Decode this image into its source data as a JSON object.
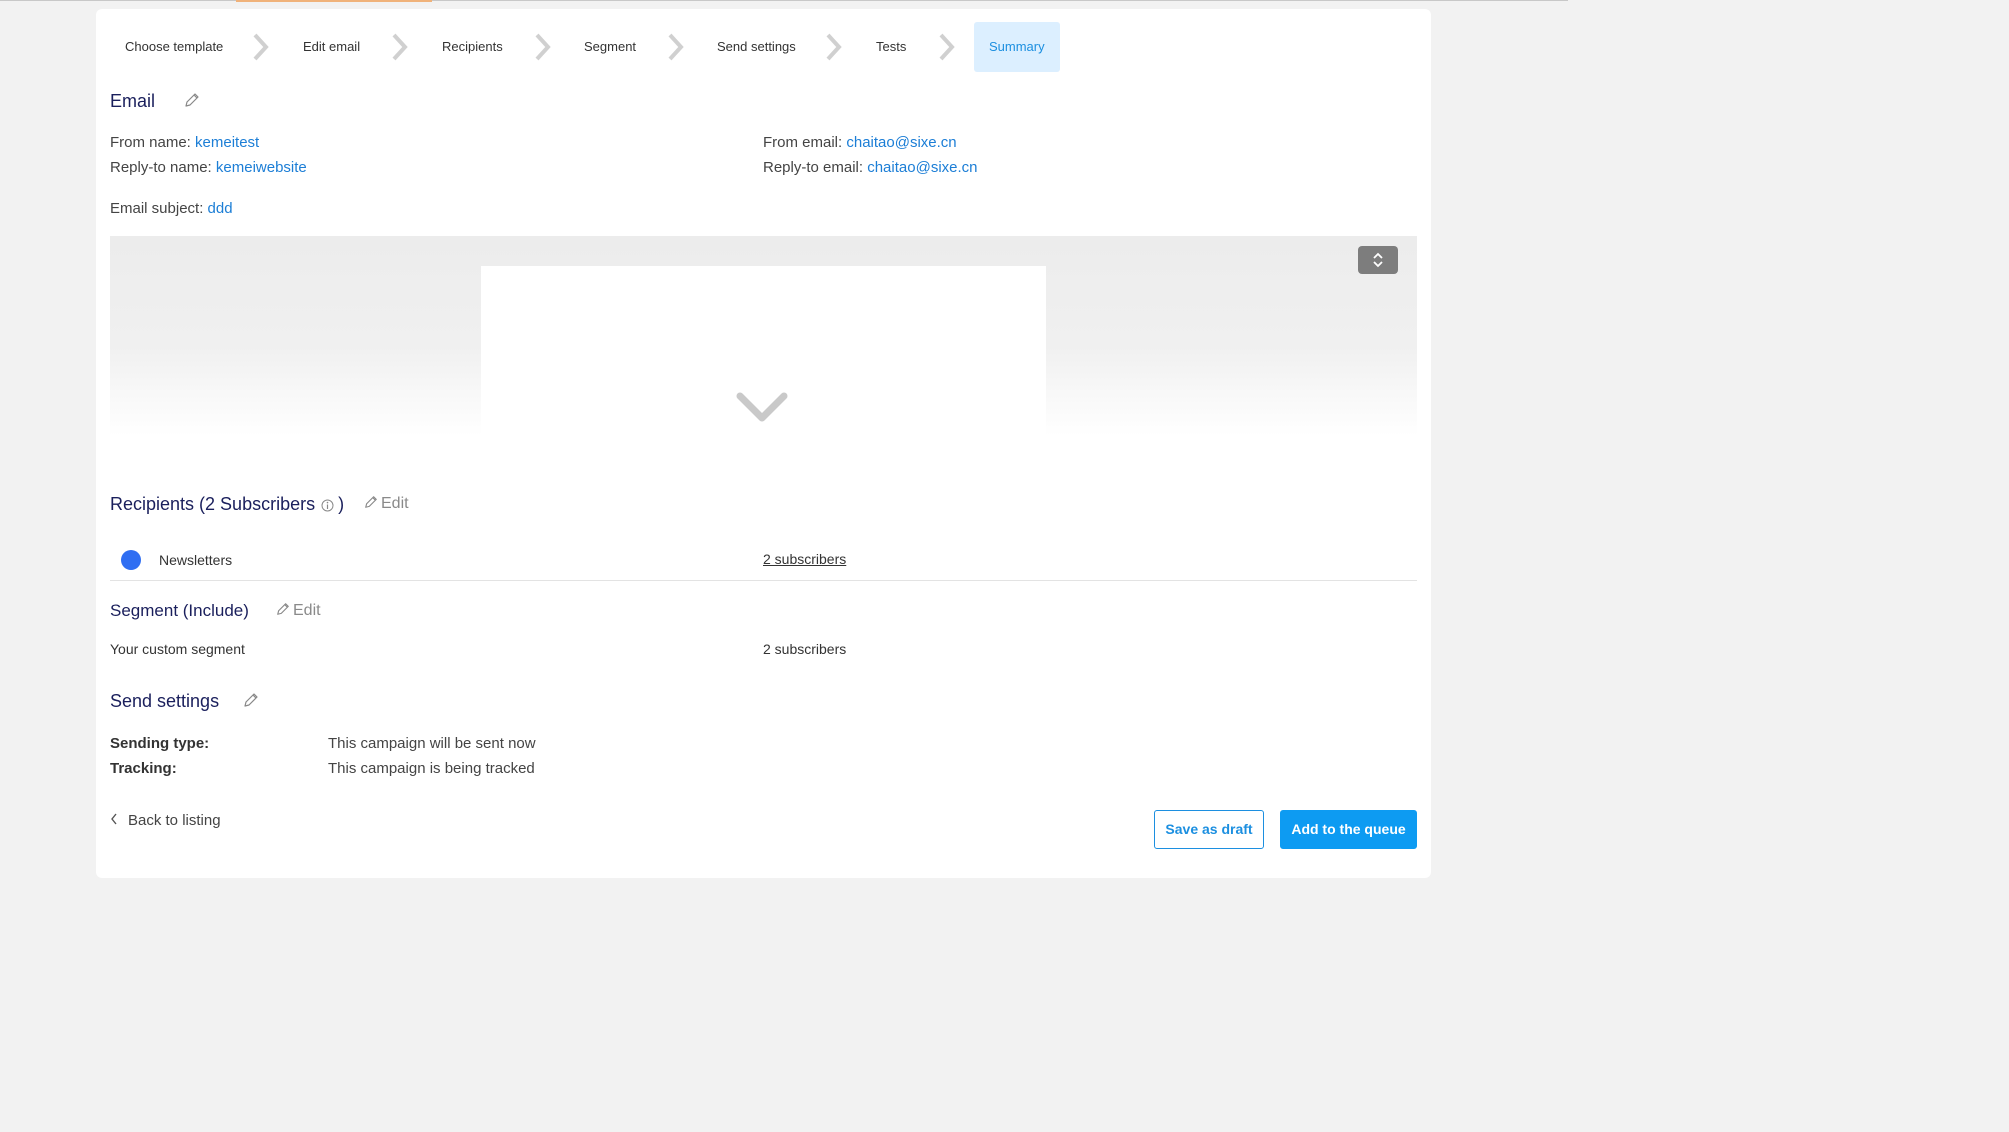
{
  "stepper": {
    "steps": [
      {
        "label": "Choose template"
      },
      {
        "label": "Edit email"
      },
      {
        "label": "Recipients"
      },
      {
        "label": "Segment"
      },
      {
        "label": "Send settings"
      },
      {
        "label": "Tests"
      },
      {
        "label": "Summary",
        "active": true
      }
    ]
  },
  "email": {
    "title": "Email",
    "from_name_label": "From name:",
    "from_name_value": "kemeitest",
    "reply_to_name_label": "Reply-to name:",
    "reply_to_name_value": "kemeiwebsite",
    "from_email_label": "From email:",
    "from_email_value": "chaitao@sixe.cn",
    "reply_to_email_label": "Reply-to email:",
    "reply_to_email_value": "chaitao@sixe.cn",
    "subject_label": "Email subject:",
    "subject_value": "ddd"
  },
  "recipients": {
    "title_prefix": "Recipients (2 Subscribers",
    "title_suffix": ")",
    "edit_label": "Edit",
    "list_name": "Newsletters",
    "list_count": "2 subscribers"
  },
  "segment": {
    "title": "Segment (Include)",
    "edit_label": "Edit",
    "name": "Your custom segment",
    "count": "2 subscribers"
  },
  "send_settings": {
    "title": "Send settings",
    "sending_type_label": "Sending type:",
    "sending_type_value": "This campaign will be sent now",
    "tracking_label": "Tracking:",
    "tracking_value": "This campaign is being tracked"
  },
  "footer": {
    "back_label": "Back to listing",
    "save_draft_label": "Save as draft",
    "add_queue_label": "Add to the queue"
  },
  "colors": {
    "accent": "#0d9bf2",
    "title": "#1a1f5c",
    "link": "#1c7ed6",
    "list_dot": "#2f6ef2",
    "active_step_bg": "#dcefff"
  }
}
